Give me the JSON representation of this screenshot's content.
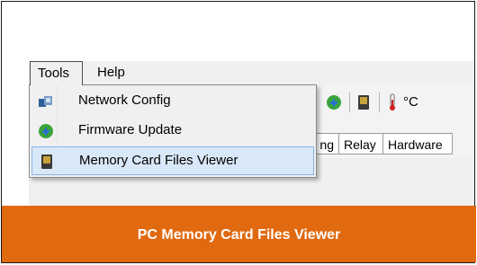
{
  "menubar": {
    "tools_label": "Tools",
    "help_label": "Help"
  },
  "tools_menu": {
    "items": [
      {
        "label": "Network Config",
        "icon": "network-config-icon"
      },
      {
        "label": "Firmware Update",
        "icon": "firmware-update-icon"
      },
      {
        "label": "Memory Card Files Viewer",
        "icon": "memory-card-icon",
        "selected": true
      }
    ]
  },
  "toolbar": {
    "temperature_unit": "°C"
  },
  "tabs": [
    {
      "label": "ng"
    },
    {
      "label": "Relay"
    },
    {
      "label": "Hardware"
    }
  ],
  "banner": {
    "title": "PC Memory Card Files Viewer",
    "color": "#e1690f"
  },
  "colors": {
    "menu_highlight_bg": "#d9e8f8",
    "menu_highlight_border": "#88b4e6"
  }
}
